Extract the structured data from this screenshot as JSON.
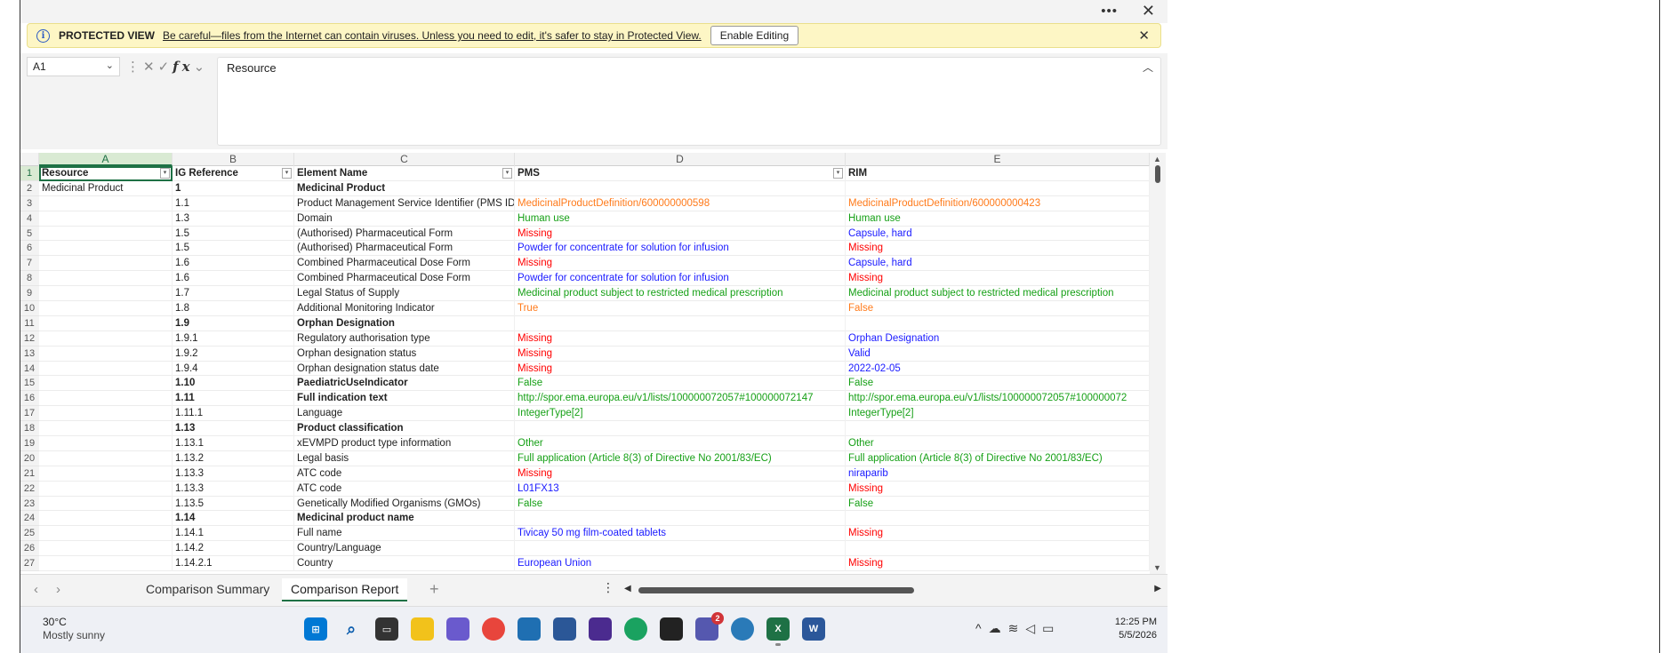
{
  "window": {
    "more_icon": "more-dots-icon",
    "close_icon": "close-icon"
  },
  "protected_view": {
    "title": "PROTECTED VIEW",
    "message": "Be careful—files from the Internet can contain viruses. Unless you need to edit, it's safer to stay in Protected View.",
    "button": "Enable Editing"
  },
  "formula_bar": {
    "name_box": "A1",
    "fx": "fx",
    "content": "Resource"
  },
  "columns": [
    "A",
    "B",
    "C",
    "D",
    "E"
  ],
  "row_numbers": [
    "1",
    "2",
    "3",
    "4",
    "5",
    "6",
    "7",
    "8",
    "9",
    "10",
    "11",
    "12",
    "13",
    "14",
    "15",
    "16",
    "17",
    "18",
    "19",
    "20",
    "21",
    "22",
    "23",
    "24",
    "25",
    "26",
    "27"
  ],
  "rows": [
    {
      "a": "Resource",
      "b": "IG Reference",
      "c": "Element Name",
      "d": "PMS",
      "e": "RIM",
      "bold": true,
      "header": true
    },
    {
      "a": "Medicinal Product",
      "b": "1",
      "c": "Medicinal Product",
      "d": "",
      "e": "",
      "boldbc": true
    },
    {
      "a": "",
      "b": "1.1",
      "c": "Product Management Service Identifier (PMS ID)",
      "d": "MedicinalProductDefinition/600000000598",
      "e": "MedicinalProductDefinition/600000000423",
      "dc": "orange",
      "ec": "orange"
    },
    {
      "a": "",
      "b": "1.3",
      "c": "Domain",
      "d": "Human use",
      "e": "Human use",
      "dc": "green",
      "ec": "green"
    },
    {
      "a": "",
      "b": "1.5",
      "c": "(Authorised) Pharmaceutical Form",
      "d": "Missing",
      "e": "Capsule, hard",
      "dc": "red",
      "ec": "blue"
    },
    {
      "a": "",
      "b": "1.5",
      "c": "(Authorised) Pharmaceutical Form",
      "d": "Powder for concentrate for solution for infusion",
      "e": "Missing",
      "dc": "blue",
      "ec": "red"
    },
    {
      "a": "",
      "b": "1.6",
      "c": "Combined Pharmaceutical Dose Form",
      "d": "Missing",
      "e": "Capsule, hard",
      "dc": "red",
      "ec": "blue"
    },
    {
      "a": "",
      "b": "1.6",
      "c": "Combined Pharmaceutical Dose Form",
      "d": "Powder for concentrate for solution for infusion",
      "e": "Missing",
      "dc": "blue",
      "ec": "red"
    },
    {
      "a": "",
      "b": "1.7",
      "c": "Legal Status of Supply",
      "d": "Medicinal product subject to restricted medical prescription",
      "e": "Medicinal product subject to restricted medical prescription",
      "dc": "green",
      "ec": "green"
    },
    {
      "a": "",
      "b": "1.8",
      "c": "Additional Monitoring Indicator",
      "d": "True",
      "e": "False",
      "dc": "orange",
      "ec": "orange"
    },
    {
      "a": "",
      "b": "1.9",
      "c": "Orphan Designation",
      "d": "",
      "e": "",
      "boldbc": true
    },
    {
      "a": "",
      "b": "1.9.1",
      "c": "Regulatory authorisation type",
      "d": "Missing",
      "e": "Orphan Designation",
      "dc": "red",
      "ec": "blue"
    },
    {
      "a": "",
      "b": "1.9.2",
      "c": "Orphan designation status",
      "d": "Missing",
      "e": "Valid",
      "dc": "red",
      "ec": "blue"
    },
    {
      "a": "",
      "b": "1.9.4",
      "c": "Orphan designation status date",
      "d": "Missing",
      "e": "2022-02-05",
      "dc": "red",
      "ec": "blue"
    },
    {
      "a": "",
      "b": "1.10",
      "c": "PaediatricUseIndicator",
      "d": "False",
      "e": "False",
      "dc": "green",
      "ec": "green",
      "boldbc": true
    },
    {
      "a": "",
      "b": "1.11",
      "c": "Full indication text",
      "d": "http://spor.ema.europa.eu/v1/lists/100000072057#100000072147",
      "e": "http://spor.ema.europa.eu/v1/lists/100000072057#100000072",
      "dc": "green",
      "ec": "green",
      "boldbc": true
    },
    {
      "a": "",
      "b": "1.11.1",
      "c": "Language",
      "d": "IntegerType[2]",
      "e": "IntegerType[2]",
      "dc": "green",
      "ec": "green"
    },
    {
      "a": "",
      "b": "1.13",
      "c": "Product classification",
      "d": "",
      "e": "",
      "boldbc": true
    },
    {
      "a": "",
      "b": "1.13.1",
      "c": "xEVMPD product type information",
      "d": "Other",
      "e": "Other",
      "dc": "green",
      "ec": "green"
    },
    {
      "a": "",
      "b": "1.13.2",
      "c": "Legal basis",
      "d": "Full application (Article 8(3) of Directive No 2001/83/EC)",
      "e": "Full application (Article 8(3) of Directive No 2001/83/EC)",
      "dc": "green",
      "ec": "green"
    },
    {
      "a": "",
      "b": "1.13.3",
      "c": "ATC code",
      "d": "Missing",
      "e": "niraparib",
      "dc": "red",
      "ec": "blue"
    },
    {
      "a": "",
      "b": "1.13.3",
      "c": "ATC code",
      "d": "L01FX13",
      "e": "Missing",
      "dc": "blue",
      "ec": "red"
    },
    {
      "a": "",
      "b": "1.13.5",
      "c": "Genetically Modified Organisms (GMOs)",
      "d": "False",
      "e": "False",
      "dc": "green",
      "ec": "green"
    },
    {
      "a": "",
      "b": "1.14",
      "c": "Medicinal product name",
      "d": "",
      "e": "",
      "boldbc": true
    },
    {
      "a": "",
      "b": "1.14.1",
      "c": "Full name",
      "d": "Tivicay 50 mg film-coated tablets",
      "e": "Missing",
      "dc": "blue",
      "ec": "red"
    },
    {
      "a": "",
      "b": "1.14.2",
      "c": "Country/Language",
      "d": "",
      "e": ""
    },
    {
      "a": "",
      "b": "1.14.2.1",
      "c": "Country",
      "d": "European Union",
      "e": "Missing",
      "dc": "blue",
      "ec": "red"
    }
  ],
  "sheet_tabs": [
    "Comparison Summary",
    "Comparison Report"
  ],
  "active_tab": "Comparison Report",
  "taskbar": {
    "temperature": "30°C",
    "weather": "Mostly sunny",
    "time": "12:25 PM",
    "date": "5/5/2026",
    "teams_badge": "2"
  }
}
